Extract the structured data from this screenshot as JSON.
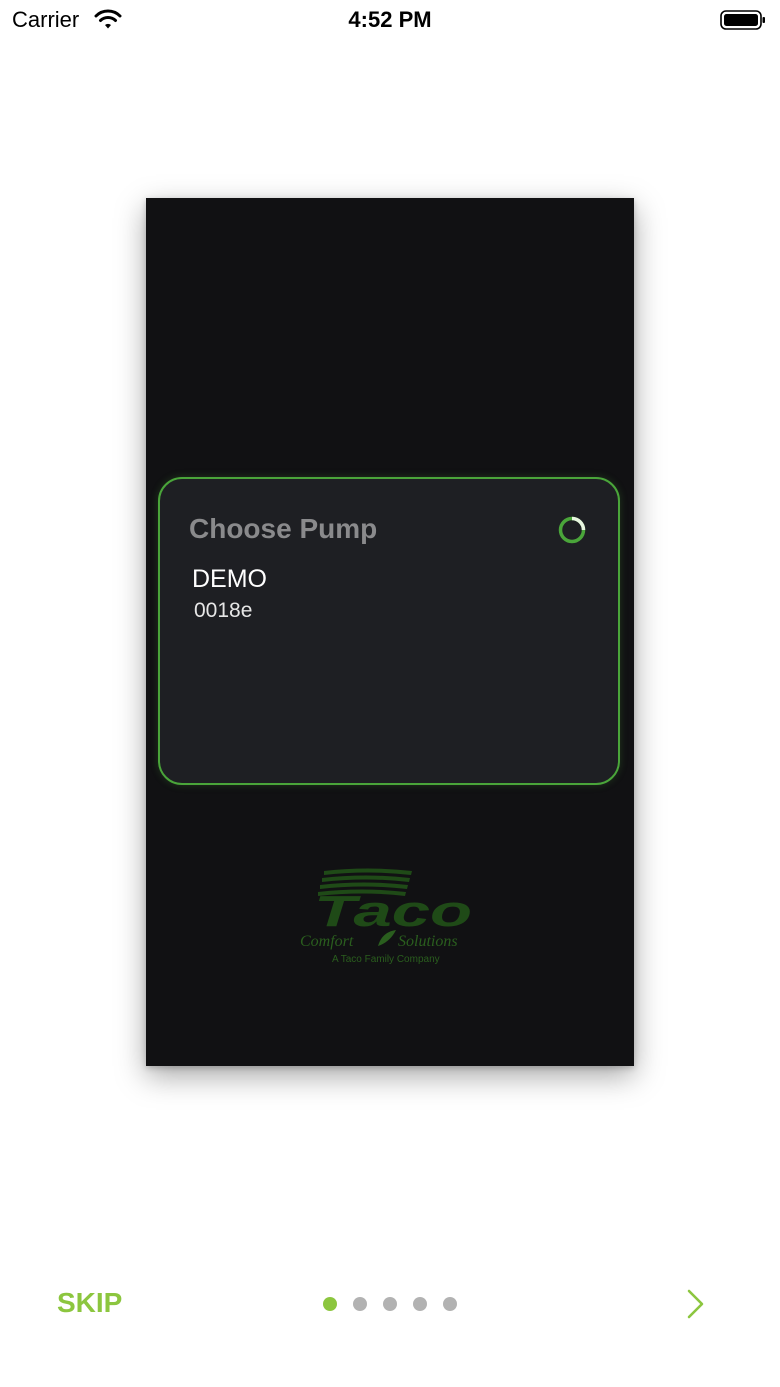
{
  "status_bar": {
    "carrier": "Carrier",
    "time": "4:52 PM",
    "icons": [
      "wifi-icon",
      "battery-icon"
    ]
  },
  "preview": {
    "card": {
      "title": "Choose Pump",
      "device_name": "DEMO",
      "device_id": "0018e",
      "icon": "loading-spinner-icon"
    },
    "logo": {
      "brand": "Taco",
      "line1": "Comfort",
      "line2": "Solutions",
      "tagline": "A Taco Family Company"
    }
  },
  "footer": {
    "skip_label": "SKIP",
    "page_count": 5,
    "current_page": 1,
    "next_icon": "chevron-right-icon"
  },
  "colors": {
    "accent": "#8cc63f",
    "card_border": "#4aa53a",
    "screen_bg": "#111113",
    "card_bg": "#1e1f23",
    "dot_inactive": "#b2b2b2"
  }
}
